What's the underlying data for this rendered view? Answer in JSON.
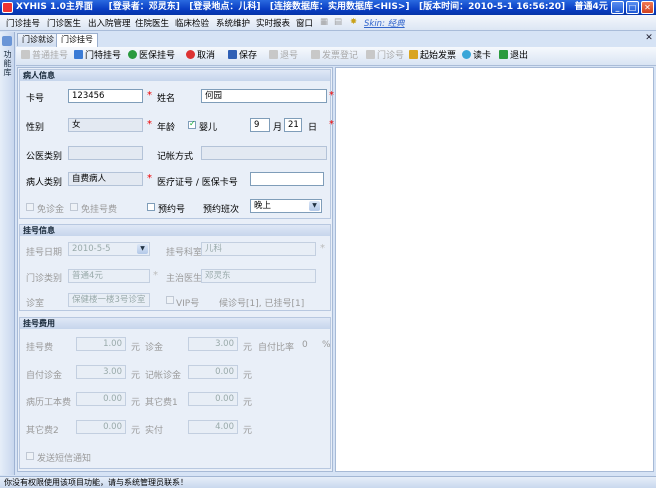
{
  "window": {
    "title": "XYHIS 1.0主界面",
    "login_user": "[登录者：邓灵东]",
    "login_place": "[登录地点：儿科]",
    "database": "[连接数据库：实用数据库<HIS>]",
    "version": "[版本时间：2010-5-1 16:56:20]",
    "level": "普通4元"
  },
  "menu": {
    "items": [
      "门诊挂号",
      "门诊医生",
      "出入院管理",
      "住院医生",
      "临床检验",
      "系统维护",
      "实时报表",
      "窗口"
    ],
    "skin": "Skin: 经典"
  },
  "side": {
    "label": "功能库"
  },
  "tabs": [
    "门诊就诊",
    "门诊挂号"
  ],
  "toolbar": {
    "items": [
      {
        "label": "普通挂号",
        "enabled": false
      },
      {
        "label": "门特挂号",
        "enabled": true
      },
      {
        "label": "医保挂号",
        "enabled": true
      },
      {
        "label": "取消",
        "enabled": true
      },
      {
        "label": "保存",
        "enabled": true
      },
      {
        "label": "退号",
        "enabled": false
      },
      {
        "label": "发票登记",
        "enabled": false
      },
      {
        "label": "门诊号",
        "enabled": false
      },
      {
        "label": "起始发票",
        "enabled": true
      },
      {
        "label": "读卡",
        "enabled": true
      },
      {
        "label": "退出",
        "enabled": true
      }
    ]
  },
  "patient": {
    "header": "病人信息",
    "card_label": "卡号",
    "card_value": "123456",
    "name_label": "姓名",
    "name_value": "何园",
    "sex_label": "性别",
    "sex_value": "女",
    "age_label": "年龄",
    "infant_label": "婴儿",
    "infant_checked": true,
    "age_month_value": "9",
    "month_unit": "月",
    "age_day_value": "21",
    "day_unit": "日",
    "public_label": "公医类别",
    "public_value": "",
    "account_label": "记帐方式",
    "account_value": "",
    "type_label": "病人类别",
    "type_value": "自费病人",
    "medcard_label": "医疗证号 / 医保卡号",
    "medcard_value": "",
    "free_exam_label": "免诊金",
    "free_reg_label": "免挂号费",
    "appoint_label": "预约号",
    "shift_label": "预约班次",
    "shift_value": "晚上"
  },
  "registration": {
    "header": "挂号信息",
    "date_label": "挂号日期",
    "date_value": "2010-5-5",
    "dept_label": "挂号科室",
    "dept_value": "儿科",
    "category_label": "门诊类别",
    "category_value": "普通4元",
    "doctor_label": "主治医生",
    "doctor_value": "邓灵东",
    "room_label": "诊室",
    "room_value": "保健楼一楼3号诊室",
    "vip_label": "VIP号",
    "queue_text": "候诊号[1], 已挂号[1]"
  },
  "fees": {
    "header": "挂号费用",
    "reg_fee_label": "挂号费",
    "reg_fee_value": "1.00",
    "yuan": "元",
    "exam_fee_label": "诊金",
    "exam_fee_value": "3.00",
    "self_ratio_label": "自付比率",
    "self_ratio_value": "0",
    "percent": "%",
    "self_exam_label": "自付诊金",
    "self_exam_value": "3.00",
    "acct_exam_label": "记帐诊金",
    "acct_exam_value": "0.00",
    "record_fee_label": "病历工本费",
    "record_fee_value": "0.00",
    "other1_label": "其它费1",
    "other1_value": "0.00",
    "other2_label": "其它费2",
    "other2_value": "0.00",
    "paid_label": "实付",
    "paid_value": "4.00",
    "sms_label": "发送短信通知"
  },
  "status": {
    "text": "你没有权限使用该项目功能，请与系统管理员联系！"
  },
  "colors": {
    "accent": "#0a3fc4",
    "required": "#e00000",
    "panel": "#e9eff8"
  }
}
